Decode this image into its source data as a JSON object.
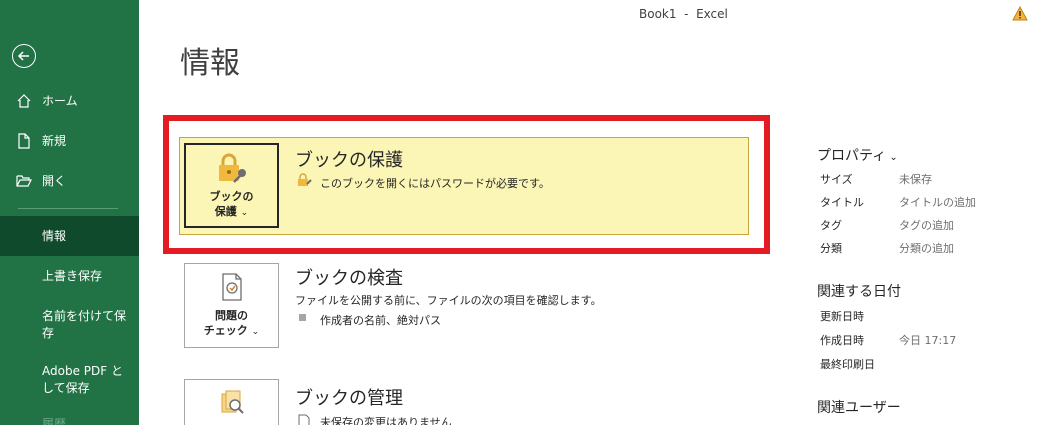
{
  "window": {
    "title": "Book1  -  Excel"
  },
  "sidebar": {
    "home": "ホーム",
    "new": "新規",
    "open": "開く",
    "info": "情報",
    "save": "上書き保存",
    "save_as": "名前を付けて保存",
    "save_pdf": "Adobe PDF として保存",
    "history": "履歴"
  },
  "main": {
    "title": "情報",
    "protect": {
      "button_label": "ブックの保護",
      "button_line1": "ブックの",
      "button_line2": "保護",
      "title": "ブックの保護",
      "description": "このブックを開くにはパスワードが必要です。"
    },
    "inspect": {
      "button_line1": "問題の",
      "button_line2": "チェック",
      "title": "ブックの検査",
      "description": "ファイルを公開する前に、ファイルの次の項目を確認します。",
      "bullet": "作成者の名前、絶対パス"
    },
    "manage": {
      "title": "ブックの管理",
      "bullet": "未保存の変更はありません"
    }
  },
  "properties": {
    "heading": "プロパティ",
    "rows": [
      {
        "key": "サイズ",
        "value": "未保存"
      },
      {
        "key": "タイトル",
        "value": "タイトルの追加"
      },
      {
        "key": "タグ",
        "value": "タグの追加"
      },
      {
        "key": "分類",
        "value": "分類の追加"
      }
    ]
  },
  "dates": {
    "heading": "関連する日付",
    "rows": [
      {
        "key": "更新日時",
        "value": ""
      },
      {
        "key": "作成日時",
        "value": "今日 17:17"
      },
      {
        "key": "最終印刷日",
        "value": ""
      }
    ]
  },
  "users": {
    "heading": "関連ユーザー"
  },
  "colors": {
    "sidebar": "#217346",
    "selected": "#0e4a2b",
    "highlight": "#fbf6b5",
    "frame": "#e31b23"
  }
}
